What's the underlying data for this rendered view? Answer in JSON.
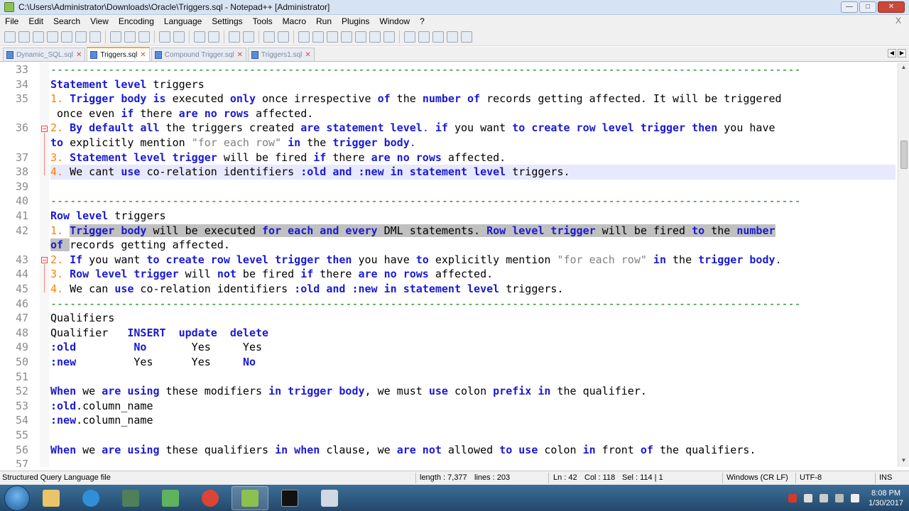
{
  "window": {
    "title": "C:\\Users\\Administrator\\Downloads\\Oracle\\Triggers.sql - Notepad++ [Administrator]",
    "min": "—",
    "max": "□",
    "close": "✕"
  },
  "menu": [
    "File",
    "Edit",
    "Search",
    "View",
    "Encoding",
    "Language",
    "Settings",
    "Tools",
    "Macro",
    "Run",
    "Plugins",
    "Window",
    "?"
  ],
  "menu_close": "X",
  "tabs": [
    {
      "label": "Dynamic_SQL.sql",
      "active": false
    },
    {
      "label": "Triggers.sql",
      "active": true
    },
    {
      "label": "Compound Trigger.sql",
      "active": false
    },
    {
      "label": "Triggers1.sql",
      "active": false
    }
  ],
  "editor": {
    "line_numbers": [
      "33",
      "34",
      "35",
      "",
      "36",
      "",
      "37",
      "38",
      "39",
      "40",
      "41",
      "42",
      "",
      "43",
      "44",
      "45",
      "46",
      "47",
      "48",
      "49",
      "50",
      "51",
      "52",
      "53",
      "54",
      "55",
      "56",
      "57"
    ],
    "text": {
      "l33": "---------------------------------------------------------------------------------------------------------------------",
      "l34a": "Statement level",
      "l34b": " triggers",
      "l35a": "1. ",
      "l35b": "Trigger body is",
      "l35c": " executed ",
      "l35d": "only",
      "l35e": " once irrespective ",
      "l35f": "of",
      "l35g": " the ",
      "l35h": "number of",
      "l35i": " records getting affected. It will be triggered",
      "l35w1": " once even ",
      "l35w2": "if",
      "l35w3": " there ",
      "l35w4": "are no rows",
      "l35w5": " affected.",
      "l36a": "2. ",
      "l36b": "By default all",
      "l36c": " the triggers created ",
      "l36d": "are statement level",
      "l36e": ". ",
      "l36f": "if",
      "l36g": " you want ",
      "l36h": "to create row level trigger then",
      "l36i": " you have",
      "l36w1": "to",
      "l36w2": " explicitly mention ",
      "l36w3": "\"for each row\"",
      "l36w4": " ",
      "l36w5": "in",
      "l36w6": " the ",
      "l36w7": "trigger body",
      "l36w8": ".",
      "l37a": "3. ",
      "l37b": "Statement level trigger",
      "l37c": " will be fired ",
      "l37d": "if",
      "l37e": " there ",
      "l37f": "are no rows",
      "l37g": " affected.",
      "l38a": "4. ",
      "l38b": "We cant ",
      "l38c": "use",
      "l38d": " co-relation identifiers ",
      "l38e": ":old and :new in statement level",
      "l38f": " triggers.",
      "l40": "---------------------------------------------------------------------------------------------------------------------",
      "l41a": "Row level",
      "l41b": " triggers",
      "l42a": "1. ",
      "l42b": "Trigger body",
      "l42c": " will be executed ",
      "l42d": "for each and every",
      "l42e": " DML statements. ",
      "l42f": "Row level trigger",
      "l42g": " will be fired ",
      "l42h": "to",
      "l42i": " the ",
      "l42j": "number",
      "l42w1": "of",
      "l42w2": " ",
      "l42w3": "records getting affected.",
      "l43a": "2. ",
      "l43b": "If",
      "l43c": " you want ",
      "l43d": "to create row level trigger then",
      "l43e": " you have ",
      "l43f": "to",
      "l43g": " explicitly mention ",
      "l43h": "\"for each row\"",
      "l43i": " ",
      "l43j": "in",
      "l43k": " the ",
      "l43l": "trigger body",
      "l43m": ".",
      "l44a": "3. ",
      "l44b": "Row level trigger",
      "l44c": " will ",
      "l44d": "not",
      "l44e": " be fired ",
      "l44f": "if",
      "l44g": " there ",
      "l44h": "are no rows",
      "l44i": " affected.",
      "l45a": "4. ",
      "l45b": "We can ",
      "l45c": "use",
      "l45d": " co-relation identifiers ",
      "l45e": ":old and :new in statement level",
      "l45f": " triggers.",
      "l46": "---------------------------------------------------------------------------------------------------------------------",
      "l47": "Qualifiers",
      "l48a": "Qualifier",
      "l48b": "   INSERT  update  delete",
      "l49a": ":old",
      "l49b": "         ",
      "l49c": "No",
      "l49d": "       Yes     Yes",
      "l50a": ":new",
      "l50b": "         Yes      Yes     ",
      "l50c": "No",
      "l52a": "When",
      "l52b": " we ",
      "l52c": "are using",
      "l52d": " these modifiers ",
      "l52e": "in trigger body",
      "l52f": ", we must ",
      "l52g": "use",
      "l52h": " colon ",
      "l52i": "prefix in",
      "l52j": " the qualifier.",
      "l53a": ":old",
      "l53b": ".column_name",
      "l54a": ":new",
      "l54b": ".column_name",
      "l56a": "When",
      "l56b": " we ",
      "l56c": "are using",
      "l56d": " these qualifiers ",
      "l56e": "in when",
      "l56f": " clause, we ",
      "l56g": "are not",
      "l56h": " allowed ",
      "l56i": "to use",
      "l56j": " colon ",
      "l56k": "in",
      "l56l": " front ",
      "l56m": "of",
      "l56n": " the qualifiers."
    }
  },
  "status": {
    "filetype": "Structured Query Language file",
    "length": "length : 7,377",
    "lines": "lines : 203",
    "ln": "Ln : 42",
    "col": "Col : 118",
    "sel": "Sel : 114 | 1",
    "eol": "Windows (CR LF)",
    "enc": "UTF-8",
    "mode": "INS"
  },
  "taskbar": {
    "time": "8:08 PM",
    "date": "1/30/2017"
  },
  "colors": {
    "keyword": "#1a1ad4",
    "number": "#ff8000",
    "string": "#808080",
    "comment": "#008000",
    "selection": "#c0c0c0"
  }
}
